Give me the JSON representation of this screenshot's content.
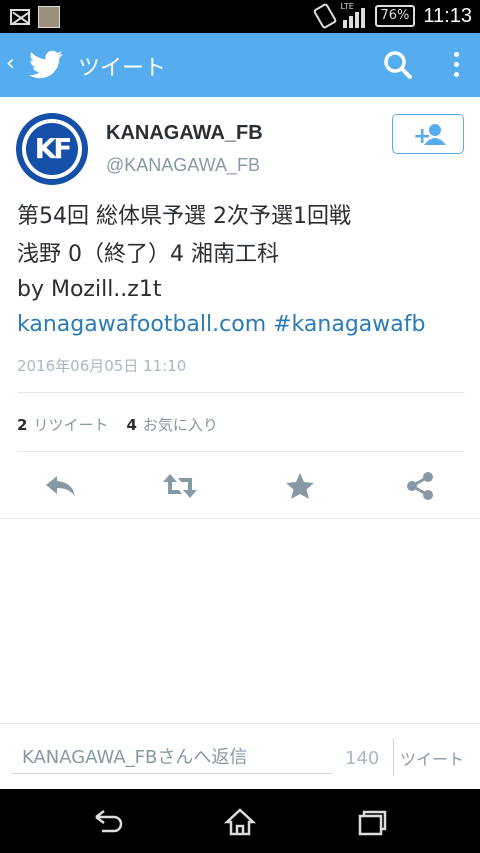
{
  "status_bar": {
    "network": "LTE",
    "battery": "76%",
    "time": "11:13"
  },
  "action_bar": {
    "title": "ツイート"
  },
  "tweet": {
    "display_name": "KANAGAWA_FB",
    "handle": "@KANAGAWA_FB",
    "avatar_letters": "KF",
    "text_line1": "第54回 総体県予選 2次予選1回戦",
    "text_line2": "浅野 0（終了）4 湘南工科",
    "text_line3": "by Mozill..z1t",
    "link_url": "kanagawafootball.com",
    "link_hashtag": "#kanagawafb",
    "timestamp": "2016年06月05日 11:10",
    "retweet_count": "2",
    "retweet_label": "リツイート",
    "favorite_count": "4",
    "favorite_label": "お気に入り"
  },
  "reply_bar": {
    "placeholder": "KANAGAWA_FBさんへ返信",
    "char_count": "140",
    "send_label": "ツイート"
  },
  "colors": {
    "brand": "#55acee",
    "link": "#2b7bb9",
    "avatar": "#1450a8"
  },
  "icons": {
    "back": "chevron-left-icon",
    "logo": "twitter-bird-icon",
    "search": "search-icon",
    "menu": "overflow-menu-icon",
    "follow": "add-user-icon",
    "reply": "reply-icon",
    "retweet": "retweet-icon",
    "favorite": "star-icon",
    "share": "share-icon",
    "nav_back": "nav-back-icon",
    "nav_home": "nav-home-icon",
    "nav_recents": "nav-recents-icon"
  }
}
